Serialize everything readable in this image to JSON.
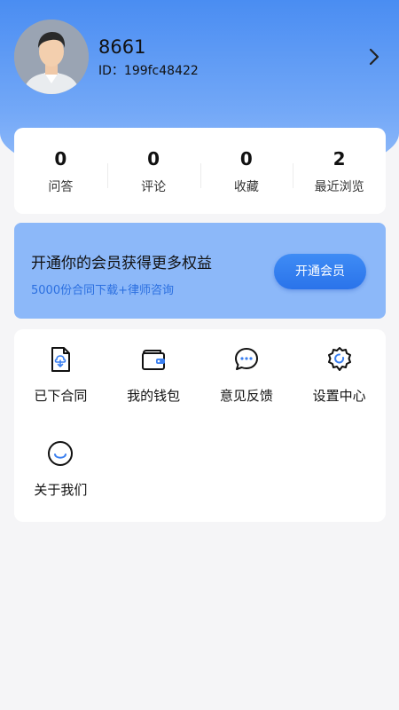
{
  "profile": {
    "username": "8661",
    "user_id": "ID：199fc48422",
    "avatar_icon": "user-avatar",
    "chevron_icon": "chevron-right-icon"
  },
  "stats": [
    {
      "value": "0",
      "label": "问答"
    },
    {
      "value": "0",
      "label": "评论"
    },
    {
      "value": "0",
      "label": "收藏"
    },
    {
      "value": "2",
      "label": "最近浏览"
    }
  ],
  "vip": {
    "title": "开通你的会员获得更多权益",
    "subtitle": "5000份合同下载+律师咨询",
    "button_label": "开通会员"
  },
  "menu": [
    {
      "label": "已下合同",
      "icon": "document-download-icon"
    },
    {
      "label": "我的钱包",
      "icon": "wallet-icon"
    },
    {
      "label": "意见反馈",
      "icon": "chat-bubble-icon"
    },
    {
      "label": "设置中心",
      "icon": "gear-icon"
    },
    {
      "label": "关于我们",
      "icon": "smile-icon"
    }
  ],
  "colors": {
    "accent": "#2a73ea",
    "header_top": "#4a8df2",
    "vip_bg": "#8cb8f9",
    "page_bg": "#f5f5f7"
  }
}
